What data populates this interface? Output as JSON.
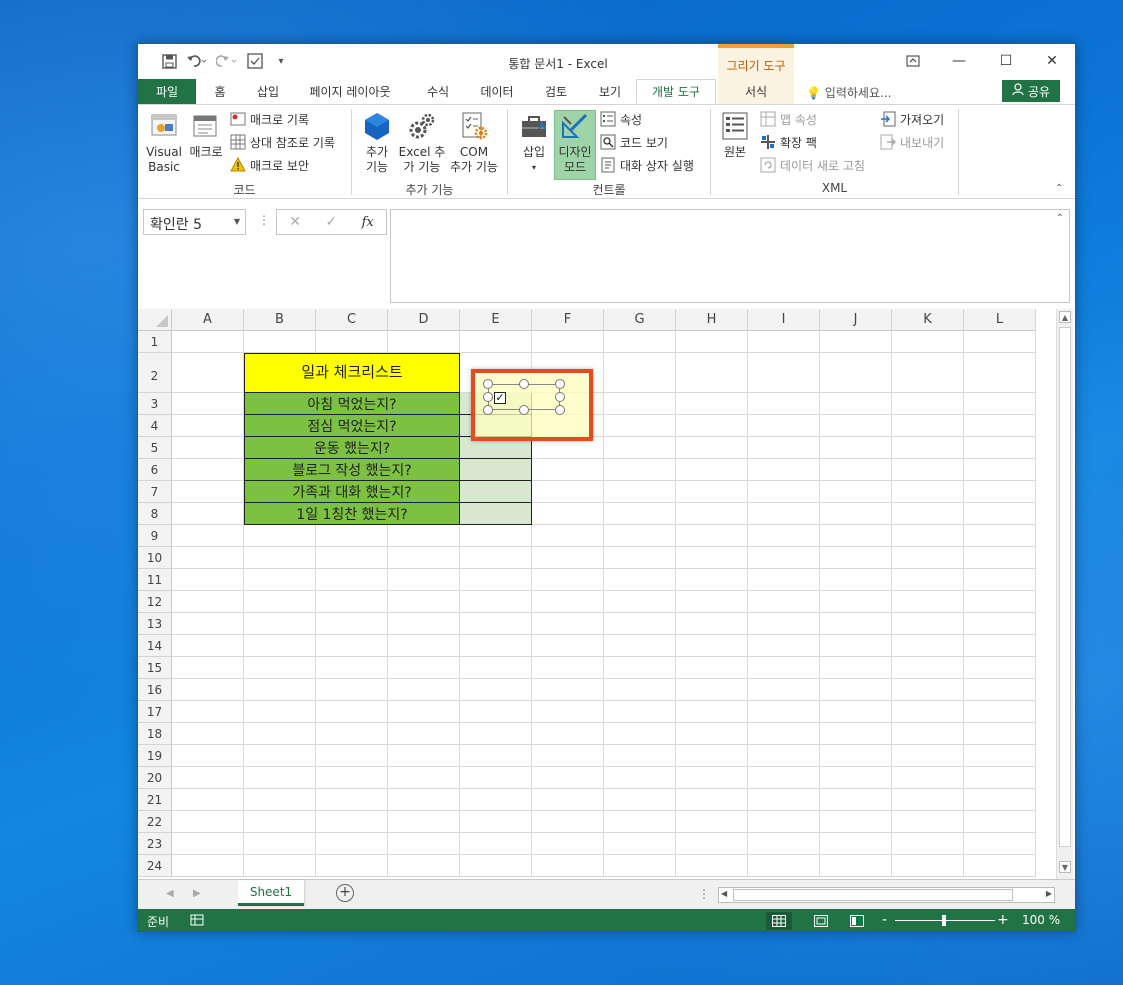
{
  "window": {
    "title": "통합 문서1 - Excel",
    "context_group": "그리기 도구"
  },
  "qat": {
    "save_icon": "save-icon",
    "undo_icon": "undo-icon",
    "redo_icon": "redo-icon",
    "form_icon": "form-icon",
    "customize": "▾"
  },
  "controls": {
    "restore": "⧉",
    "minimize": "—",
    "maximize": "☐",
    "close": "✕"
  },
  "tabs": [
    "파일",
    "홈",
    "삽입",
    "페이지 레이아웃",
    "수식",
    "데이터",
    "검토",
    "보기",
    "개발 도구",
    "서식"
  ],
  "tell_me": "입력하세요...",
  "share": "공유",
  "ribbon": {
    "code": {
      "label": "코드",
      "visual_basic": [
        "Visual",
        "Basic"
      ],
      "macro": "매크로",
      "record_macro": "매크로 기록",
      "relative_ref": "상대 참조로 기록",
      "macro_security": "매크로 보안"
    },
    "addins": {
      "label": "추가 기능",
      "addins_btn": [
        "추가",
        "기능"
      ],
      "excel_addins": [
        "Excel 추",
        "가 기능"
      ],
      "com_addins": [
        "COM",
        "추가 기능"
      ]
    },
    "controls": {
      "label": "컨트롤",
      "insert": "삽입",
      "design_mode": [
        "디자인",
        "모드"
      ],
      "properties": "속성",
      "view_code": "코드 보기",
      "run_dialog": "대화 상자 실행"
    },
    "xml": {
      "label": "XML",
      "source": "원본",
      "map_properties": "맵 속성",
      "expansion_packs": "확장 팩",
      "refresh_data": "데이터 새로 고침",
      "import": "가져오기",
      "export": "내보내기"
    }
  },
  "formula_bar": {
    "name_box": "확인란 5",
    "fx": "fx",
    "cancel": "✕",
    "enter": "✓",
    "value": ""
  },
  "columns": [
    "A",
    "B",
    "C",
    "D",
    "E",
    "F",
    "G",
    "H",
    "I",
    "J",
    "K",
    "L"
  ],
  "rows": [
    "1",
    "2",
    "3",
    "4",
    "5",
    "6",
    "7",
    "8",
    "9",
    "10",
    "11",
    "12",
    "13",
    "14",
    "15",
    "16",
    "17",
    "18",
    "19",
    "20",
    "21",
    "22",
    "23",
    "24"
  ],
  "checklist": {
    "title": "일과 체크리스트",
    "items": [
      "아침 먹었는지?",
      "점심 먹었는지?",
      "운동 했는지?",
      "블로그 작성 했는지?",
      "가족과 대화 했는지?",
      "1일 1칭찬 했는지?"
    ]
  },
  "checkbox": {
    "checked": true,
    "mark": "✓"
  },
  "sheets": {
    "active": "Sheet1",
    "add": "+"
  },
  "status": {
    "ready": "준비",
    "zoom": "100 %",
    "zoom_minus": "-",
    "zoom_plus": "+"
  },
  "colors": {
    "excel_green": "#217346",
    "title_yellow": "#ffff00",
    "item_green": "#7dc142",
    "check_cell": "#d8e8d0",
    "highlight": "#e8491d"
  }
}
